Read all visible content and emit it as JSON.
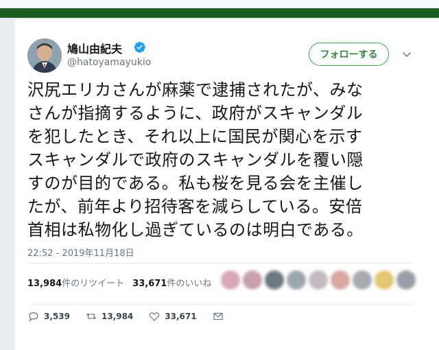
{
  "user": {
    "display_name": "鳩山由紀夫",
    "handle": "@hatoyamayukio"
  },
  "follow_label": "フォローする",
  "tweet_lines": [
    "沢尻エリカさんが麻薬で逮捕されたが、みな",
    "さんが指摘するように、政府がスキャンダル",
    "を犯したとき、それ以上に国民が関心を示す",
    "スキャンダルで政府のスキャンダルを覆い隠",
    "すのが目的である。私も桜を見る会を主催し",
    "たが、前年より招待客を減らしている。安倍",
    "首相は私物化し過ぎているのは明白である。"
  ],
  "timestamp": "22:52 - 2019年11月18日",
  "stats": {
    "retweets_count": "13,984",
    "retweets_label": "件のリツイート",
    "likes_count": "33,671",
    "likes_label": "件のいいね"
  },
  "actions": {
    "replies": "3,539",
    "retweets": "13,984",
    "likes": "33,671"
  },
  "liker_colors": [
    "#d8a6b8",
    "#c99fb0",
    "#6b7a82",
    "#9aa6ad",
    "#c4b8c0",
    "#d9a7a0",
    "#a5aab0",
    "#e0c870",
    "#9a9ea6"
  ],
  "colors": {
    "follow_accent": "#2e8b3a",
    "topbar": "#1b5e20",
    "text": "#14171a",
    "secondary": "#657786",
    "verified": "#1da1f2"
  }
}
